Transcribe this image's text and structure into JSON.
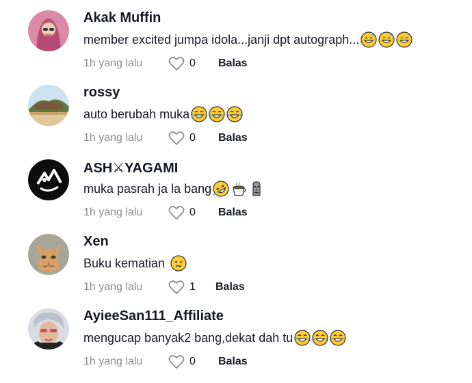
{
  "comments": [
    {
      "username": "Akak Muffin",
      "text": "member excited jumpa idola...janji dpt autograph...",
      "emojis": [
        "grin-sweat-emoji",
        "grin-sweat-emoji",
        "grin-sweat-emoji"
      ],
      "time": "1h yang lalu",
      "likes": "0",
      "reply": "Balas",
      "avatar": "woman-hijab-avatar"
    },
    {
      "username": "rossy",
      "text": "auto berubah muka",
      "emojis": [
        "tears-of-joy-emoji",
        "tears-of-joy-emoji",
        "tears-of-joy-emoji"
      ],
      "time": "1h yang lalu",
      "likes": "0",
      "reply": "Balas",
      "avatar": "landscape-avatar"
    },
    {
      "username": "ASH⚔YAGAMI",
      "text": "muka pasrah ja la bang",
      "emojis": [
        "rolling-laughing-emoji",
        "hot-beverage-emoji",
        "moai-emoji"
      ],
      "time": "1h yang lalu",
      "likes": "0",
      "reply": "Balas",
      "avatar": "black-white-logo-avatar"
    },
    {
      "username": "Xen",
      "text": "Buku kematian",
      "emojis": [
        "confused-face-emoji"
      ],
      "time": "1h yang lalu",
      "likes": "1",
      "reply": "Balas",
      "avatar": "cat-avatar"
    },
    {
      "username": "AyieeSan111_Affiliate",
      "text": "mengucap banyak2 bang,dekat dah tu",
      "emojis": [
        "tears-of-joy-emoji",
        "tears-of-joy-emoji",
        "tears-of-joy-emoji"
      ],
      "time": "1h yang lalu",
      "likes": "0",
      "reply": "Balas",
      "avatar": "person-avatar"
    }
  ]
}
